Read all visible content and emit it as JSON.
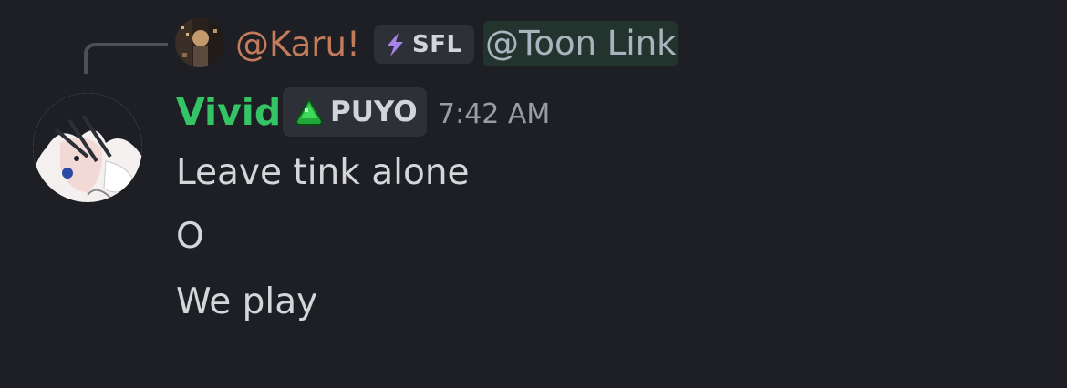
{
  "reply": {
    "author": "@Karu!",
    "tag_label": "SFL",
    "mention": "@Toon Link",
    "tag_icon": "lightning-bolt-icon"
  },
  "message": {
    "author": "Vivid",
    "tag_label": "PUYO",
    "tag_icon": "green-slime-icon",
    "timestamp": "7:42 AM",
    "lines": [
      "Leave tink alone",
      "O",
      "We play"
    ]
  },
  "colors": {
    "background": "#1e1f24",
    "reply_author": "#c37c5b",
    "author": "#34c365",
    "mention_bg": "#23342f",
    "tag_bg": "#2e3038",
    "text": "#d5d6da",
    "timestamp": "#9a9ca5"
  }
}
